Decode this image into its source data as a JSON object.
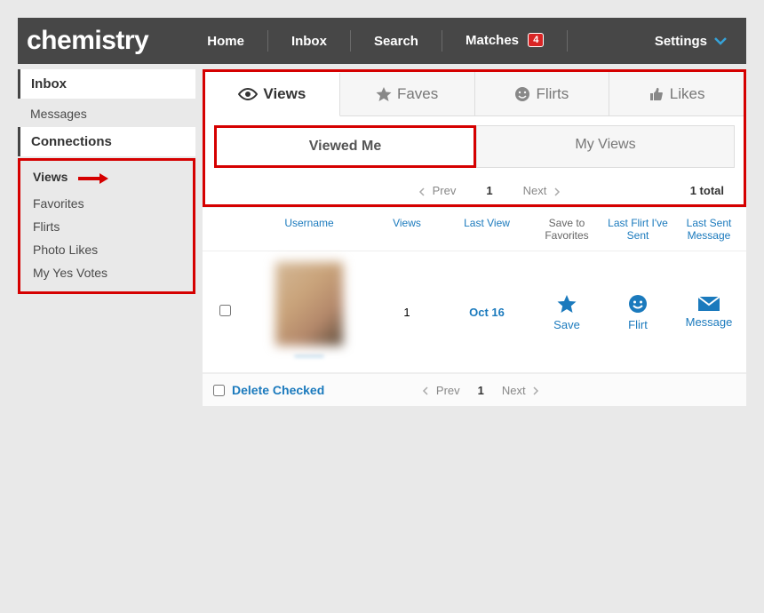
{
  "brand": "chemistry",
  "nav": {
    "home": "Home",
    "inbox": "Inbox",
    "search": "Search",
    "matches": "Matches",
    "matches_badge": "4",
    "settings": "Settings"
  },
  "sidebar": {
    "inbox_header": "Inbox",
    "messages": "Messages",
    "connections_header": "Connections",
    "items": {
      "views": "Views",
      "favorites": "Favorites",
      "flirts": "Flirts",
      "photo_likes": "Photo Likes",
      "my_yes_votes": "My Yes Votes"
    }
  },
  "tabs": {
    "views": "Views",
    "faves": "Faves",
    "flirts": "Flirts",
    "likes": "Likes"
  },
  "subtabs": {
    "viewed_me": "Viewed Me",
    "my_views": "My Views"
  },
  "pager": {
    "prev": "Prev",
    "page": "1",
    "next": "Next",
    "total": "1 total"
  },
  "columns": {
    "username": "Username",
    "views": "Views",
    "last_view": "Last View",
    "save_to_favorites": "Save to Favorites",
    "last_flirt": "Last Flirt I've Sent",
    "last_sent_msg": "Last Sent Message"
  },
  "row": {
    "views": "1",
    "last_view": "Oct 16",
    "save": "Save",
    "flirt": "Flirt",
    "message": "Message"
  },
  "footer": {
    "delete_checked": "Delete Checked"
  }
}
